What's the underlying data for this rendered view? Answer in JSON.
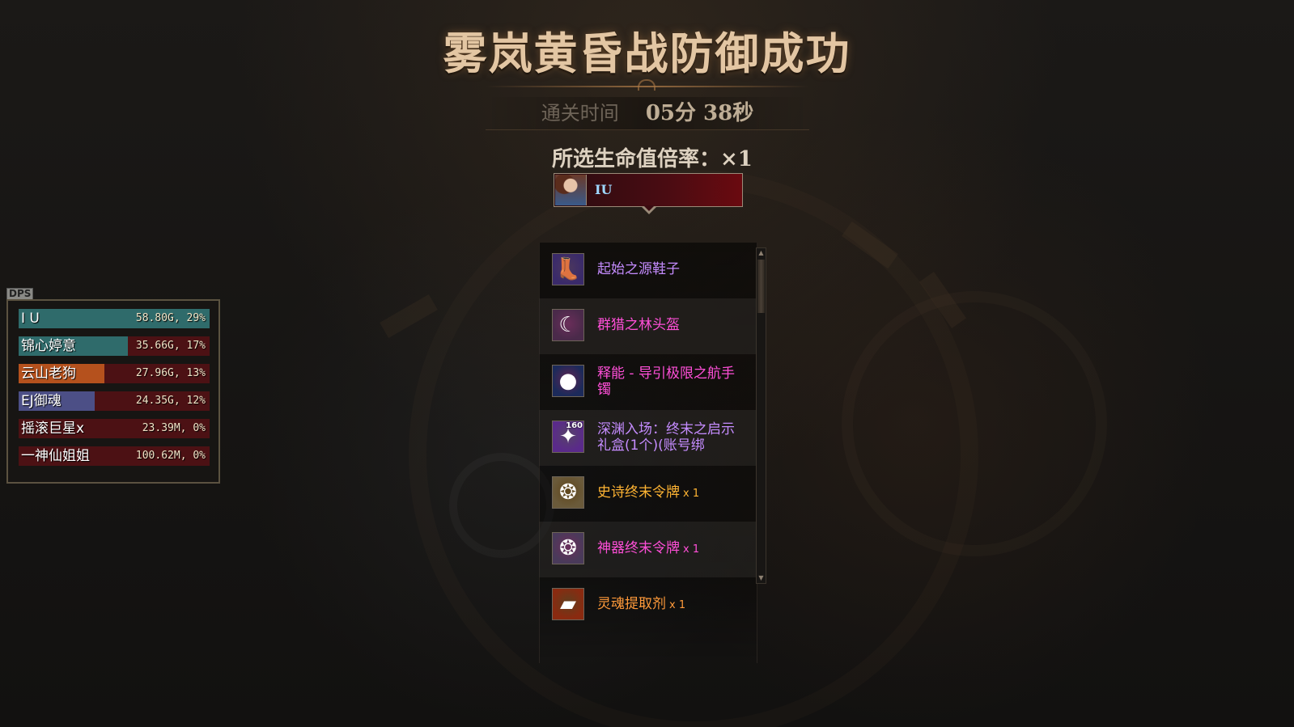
{
  "title": "雾岚黄昏战防御成功",
  "clear_time": {
    "label": "通关时间",
    "value": "05分 38秒"
  },
  "hp_rate": {
    "text": "所选生命值倍率：×1"
  },
  "player": {
    "name": "IU"
  },
  "loot_items": [
    {
      "name": "起始之源鞋子",
      "qty": "",
      "color": "#c58cff",
      "icon": "boots-icon",
      "icon_glyph": "👢",
      "icon_bg": "#3a2a6a"
    },
    {
      "name": "群猎之林头盔",
      "qty": "",
      "color": "#ff4fd8",
      "icon": "helmet-icon",
      "icon_glyph": "☾",
      "icon_bg": "#4a2a4a"
    },
    {
      "name": "释能 - 导引极限之航手镯",
      "qty": "",
      "color": "#ff4fd8",
      "icon": "bracelet-icon",
      "icon_glyph": "●",
      "icon_bg": "#1c2a5a"
    },
    {
      "name": "深渊入场：终末之启示礼盒(1个)(账号绑",
      "qty": "",
      "color": "#c58cff",
      "icon": "gift-box-icon",
      "icon_glyph": "✦",
      "icon_bg": "#5a2a8a",
      "badge": "160"
    },
    {
      "name": "史诗终末令牌",
      "qty": "x 1",
      "color": "#ffb433",
      "icon": "epic-token-icon",
      "icon_glyph": "❂",
      "icon_bg": "#6a5a3a"
    },
    {
      "name": "神器终末令牌",
      "qty": "x 1",
      "color": "#ff4fd8",
      "icon": "artifact-token-icon",
      "icon_glyph": "❂",
      "icon_bg": "#4a3a5a"
    },
    {
      "name": "灵魂提取剂",
      "qty": "x 1",
      "color": "#ff9a3a",
      "icon": "soul-extractor-icon",
      "icon_glyph": "▰",
      "icon_bg": "#8a2a10"
    }
  ],
  "dps": {
    "tag": "DPS",
    "rows": [
      {
        "name": "I U",
        "value": "58.80G, 29%",
        "fill": 1.0,
        "color": "#2f6b6b"
      },
      {
        "name": "锦心婷意",
        "value": "35.66G, 17%",
        "fill": 0.57,
        "color": "#2f6b6b"
      },
      {
        "name": "云山老狗",
        "value": "27.96G, 13%",
        "fill": 0.45,
        "color": "#b5511d"
      },
      {
        "name": "EJ御魂",
        "value": "24.35G, 12%",
        "fill": 0.4,
        "color": "#4c4f86"
      },
      {
        "name": "摇滚巨星x",
        "value": "23.39M, 0%",
        "fill": 0.0,
        "color": "#4c1114"
      },
      {
        "name": "一神仙姐姐",
        "value": "100.62M, 0%",
        "fill": 0.0,
        "color": "#4c1114"
      }
    ]
  }
}
